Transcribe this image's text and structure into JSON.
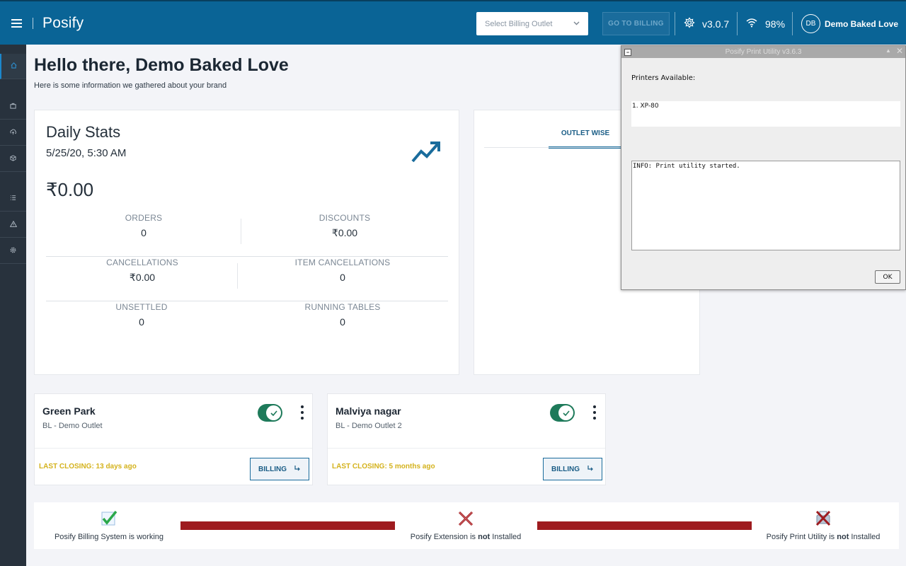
{
  "header": {
    "brand": "Posify",
    "outlet_select_placeholder": "Select Billing Outlet",
    "go_billing_label": "GO TO BILLING",
    "version": "v3.0.7",
    "wifi_strength": "98%",
    "user_initials": "DB",
    "user_name": "Demo Baked Love"
  },
  "sidebar": {
    "items": [
      {
        "icon": "home-icon",
        "active": true
      },
      {
        "icon": "briefcase-icon",
        "active": false
      },
      {
        "icon": "upload-icon",
        "active": false
      },
      {
        "icon": "box-icon",
        "active": false
      },
      {
        "icon": "list-icon",
        "active": false
      },
      {
        "icon": "warning-icon",
        "active": false
      },
      {
        "icon": "gear-icon",
        "active": false
      }
    ]
  },
  "main": {
    "greeting": "Hello there, Demo Baked Love",
    "subtitle": "Here is some information we gathered about your brand"
  },
  "daily_stats": {
    "title": "Daily Stats",
    "date": "5/25/20, 5:30 AM",
    "total": "₹0.00",
    "orders_label": "ORDERS",
    "orders_value": "0",
    "discounts_label": "DISCOUNTS",
    "discounts_value": "₹0.00",
    "cancellations_label": "CANCELLATIONS",
    "cancellations_value": "₹0.00",
    "item_cancellations_label": "ITEM CANCELLATIONS",
    "item_cancellations_value": "0",
    "unsettled_label": "UNSETTLED",
    "unsettled_value": "0",
    "running_tables_label": "RUNNING TABLES",
    "running_tables_value": "0"
  },
  "right_panel": {
    "tab_outlet_wise": "OUTLET WISE"
  },
  "outlets": [
    {
      "name": "Green Park",
      "sub": "BL - Demo Outlet",
      "last_closing": "LAST CLOSING: 13 days ago",
      "billing_label": "BILLING",
      "enabled": true
    },
    {
      "name": "Malviya nagar",
      "sub": "BL - Demo Outlet 2",
      "last_closing": "LAST CLOSING: 5 months ago",
      "billing_label": "BILLING",
      "enabled": true
    }
  ],
  "status": {
    "billing": {
      "text": "Posify Billing System is working"
    },
    "extension": {
      "prefix": "Posify Extension is ",
      "bold": "not",
      "suffix": " Installed"
    },
    "print_utility": {
      "prefix": "Posify Print Utility is ",
      "bold": "not",
      "suffix": " Installed"
    },
    "colors": {
      "ok": "#2ba84a",
      "fail": "#9e1b1f"
    }
  },
  "dialog": {
    "title": "Posify Print Utility v3.6.3",
    "printers_label": "Printers Available:",
    "printers_list": "1. XP-80",
    "log": "INFO: Print utility started.",
    "ok_label": "OK"
  }
}
